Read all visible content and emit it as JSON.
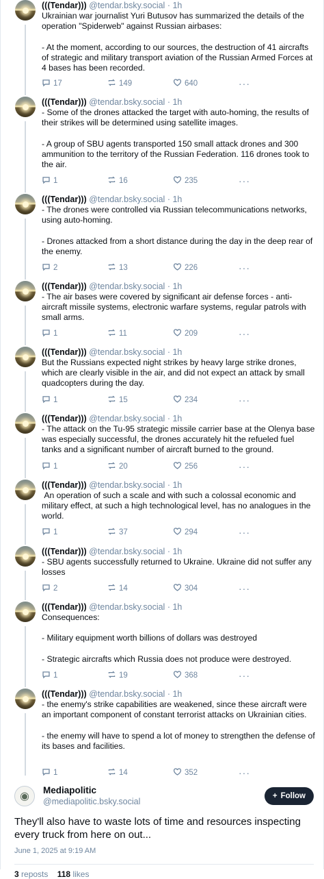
{
  "thread": [
    {
      "name": "(((Tendar)))",
      "handle": "@tendar.bsky.social",
      "sep": " · ",
      "time": "1h",
      "text": "Ukrainian war journalist Yuri Butusov has summarized the details of the operation \"Spiderweb\" against Russian airbases:\n\n- At the moment, according to our sources, the destruction of 41 aircrafts of strategic and military transport aviation of the Russian Armed Forces at 4 bases has been recorded.",
      "replies": "17",
      "reposts": "149",
      "likes": "640"
    },
    {
      "name": "(((Tendar)))",
      "handle": "@tendar.bsky.social",
      "sep": " · ",
      "time": "1h",
      "text": "- Some of the drones attacked the target with auto-homing, the results of their strikes will be determined using satellite images.\n\n- A group of SBU agents transported 150 small attack drones and 300 ammunition to the territory of the Russian Federation. 116 drones took to the air.",
      "replies": "1",
      "reposts": "16",
      "likes": "235"
    },
    {
      "name": "(((Tendar)))",
      "handle": "@tendar.bsky.social",
      "sep": " · ",
      "time": "1h",
      "text": "- The drones were controlled via Russian telecommunications networks, using auto-homing.\n\n- Drones attacked from a short distance during the day in the deep rear of the enemy.",
      "replies": "2",
      "reposts": "13",
      "likes": "226"
    },
    {
      "name": "(((Tendar)))",
      "handle": "@tendar.bsky.social",
      "sep": " · ",
      "time": "1h",
      "text": "- The air bases were covered by significant air defense forces - anti-aircraft missile systems, electronic warfare systems, regular patrols with small arms.",
      "replies": "1",
      "reposts": "11",
      "likes": "209"
    },
    {
      "name": "(((Tendar)))",
      "handle": "@tendar.bsky.social",
      "sep": " · ",
      "time": "1h",
      "text": "But the Russians expected night strikes by heavy large strike drones, which are clearly visible in the air, and did not expect an attack by small quadcopters during the day.",
      "replies": "1",
      "reposts": "15",
      "likes": "234"
    },
    {
      "name": "(((Tendar)))",
      "handle": "@tendar.bsky.social",
      "sep": " · ",
      "time": "1h",
      "text": "- The attack on the Tu-95 strategic missile carrier base at the Olenya base was especially successful, the drones accurately hit the refueled fuel tanks and a significant number of aircraft burned to the ground.",
      "replies": "1",
      "reposts": "20",
      "likes": "256"
    },
    {
      "name": "(((Tendar)))",
      "handle": "@tendar.bsky.social",
      "sep": " · ",
      "time": "1h",
      "text": " An operation of such a scale and with such a colossal economic and military effect, at such a high technological level, has no analogues in the world.",
      "replies": "1",
      "reposts": "37",
      "likes": "294"
    },
    {
      "name": "(((Tendar)))",
      "handle": "@tendar.bsky.social",
      "sep": " · ",
      "time": "1h",
      "text": "- SBU agents successfully returned to Ukraine. Ukraine did not suffer any losses",
      "replies": "2",
      "reposts": "14",
      "likes": "304"
    },
    {
      "name": "(((Tendar)))",
      "handle": "@tendar.bsky.social",
      "sep": " · ",
      "time": "1h",
      "text": "Consequences:\n\n- Military equipment worth billions of dollars was destroyed\n\n- Strategic aircrafts which Russia does not produce were destroyed.",
      "replies": "1",
      "reposts": "19",
      "likes": "368"
    },
    {
      "name": "(((Tendar)))",
      "handle": "@tendar.bsky.social",
      "sep": " · ",
      "time": "1h",
      "text": "- the enemy's strike capabilities are weakened, since these aircraft were an important component of constant terrorist attacks on Ukrainian cities.\n\n- the enemy will have to spend a lot of money to strengthen the defense of its bases and facilities.",
      "replies": "1",
      "reposts": "14",
      "likes": "352"
    }
  ],
  "main_post": {
    "name": "Mediapolitic",
    "handle": "@mediapolitic.bsky.social",
    "follow_label": "Follow",
    "text": "They'll also have to waste lots of time and resources inspecting every truck from here on out...",
    "date": "June 1, 2025 at 9:19 AM",
    "reposts_count": "3",
    "reposts_label": "reposts",
    "likes_count": "118",
    "likes_label": "likes"
  },
  "colors": {
    "muted": "#6f869f",
    "text": "#0b0f14",
    "follow_bg": "#1a2433",
    "rail": "#d4dbe2"
  },
  "icons": {
    "reply": "speech-bubble-icon",
    "repost": "repost-arrows-icon",
    "like": "heart-icon",
    "more": "ellipsis-icon",
    "follow": "plus-icon"
  }
}
